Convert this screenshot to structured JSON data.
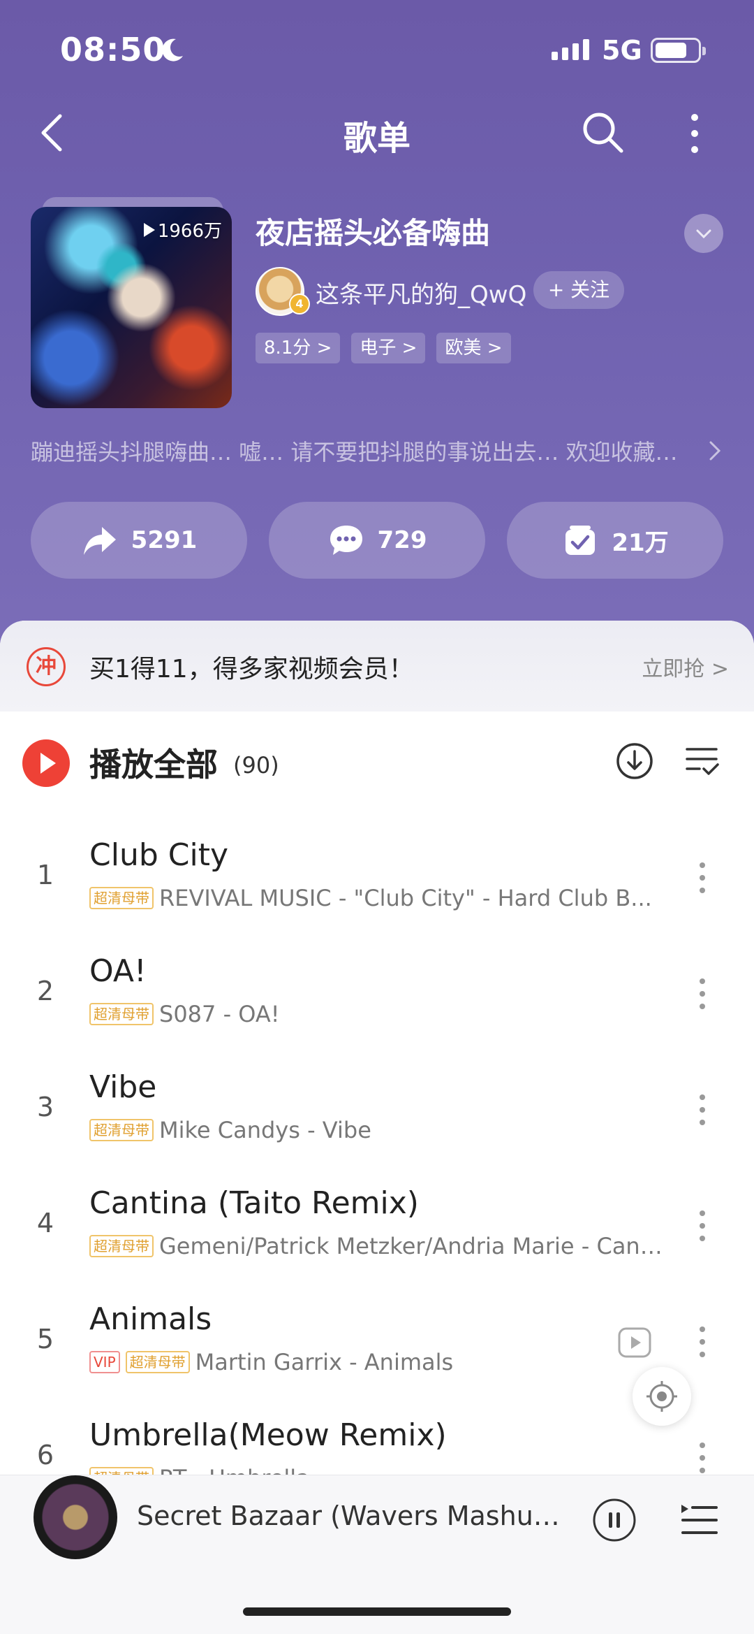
{
  "status_bar": {
    "time": "08:50",
    "network": "5G"
  },
  "nav": {
    "title": "歌单"
  },
  "playlist": {
    "play_count": "1966万",
    "title": "夜店摇头必备嗨曲",
    "creator": "这条平凡的狗_QwQ",
    "avatar_level": "4",
    "follow_label": "+ 关注",
    "tags": [
      "8.1分 >",
      "电子 >",
      "欧美 >"
    ],
    "description": "蹦迪摇头抖腿嗨曲… 嘘… 请不要把抖腿的事说出去… 欢迎收藏…"
  },
  "actions": {
    "share_count": "5291",
    "comment_count": "729",
    "collect_count": "21万"
  },
  "promo": {
    "icon_text": "冲",
    "text": "买1得11，得多家视频会员！",
    "cta": "立即抢 >"
  },
  "play_all": {
    "label": "播放全部",
    "count": "(90)"
  },
  "badges": {
    "hq": "超清母带",
    "vip": "VIP"
  },
  "songs": [
    {
      "num": "1",
      "title": "Club City",
      "artist": "REVIVAL MUSIC - \"Club City\" - Hard Club B..."
    },
    {
      "num": "2",
      "title": "OA!",
      "artist": "S087 - OA!"
    },
    {
      "num": "3",
      "title": "Vibe",
      "artist": "Mike Candys - Vibe"
    },
    {
      "num": "4",
      "title": "Cantina (Taito Remix)",
      "artist": "Gemeni/Patrick Metzker/Andria Marie - Canti..."
    },
    {
      "num": "5",
      "title": "Animals",
      "artist": "Martin Garrix - Animals"
    },
    {
      "num": "6",
      "title": "Umbrella(Meow Remix)",
      "artist": "RT - Umbrella"
    }
  ],
  "now_playing": {
    "title": "Secret Bazaar (Wavers Mashup)..."
  },
  "colors": {
    "hero": "#6b5aa8",
    "accent": "#ee4136",
    "hq_badge": "#e0a030"
  }
}
